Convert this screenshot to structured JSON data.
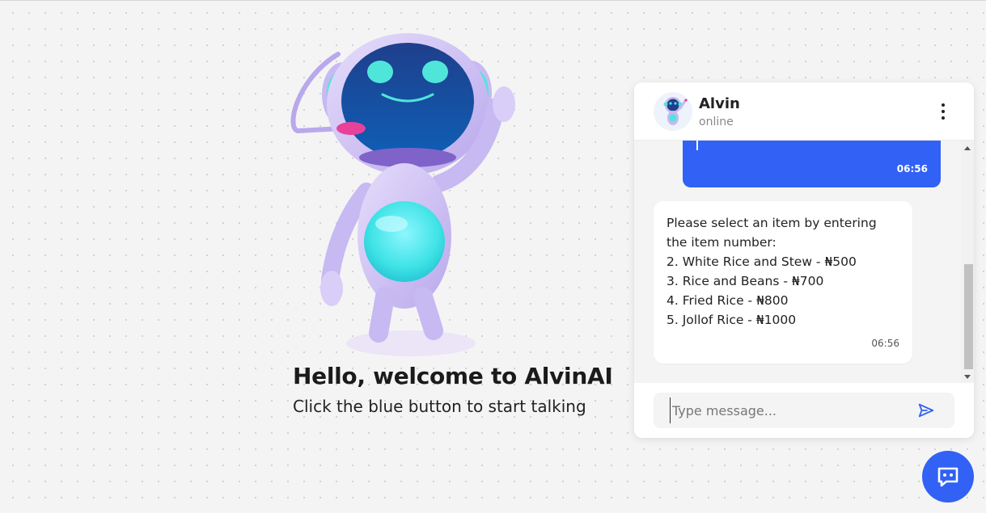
{
  "hero": {
    "title": "Hello, welcome to AlvinAI",
    "subtitle": "Click the blue button to start talking",
    "image_icon": "robot-mascot-icon"
  },
  "chat": {
    "header": {
      "name": "Alvin",
      "status": "online",
      "avatar_icon": "robot-avatar-icon",
      "menu_icon": "vertical-dots-icon"
    },
    "messages": [
      {
        "sender": "user",
        "time": "06:56"
      },
      {
        "sender": "bot",
        "lines": [
          "Please select an item by entering",
          "the item number:",
          "2. White Rice and Stew - ₦500",
          "3. Rice and Beans - ₦700",
          "4. Fried Rice - ₦800",
          "5. Jollof Rice - ₦1000"
        ],
        "time": "06:56"
      }
    ],
    "input": {
      "placeholder": "Type message...",
      "value": ""
    },
    "send_icon": "send-icon"
  },
  "launcher": {
    "icon": "chat-bubble-icon"
  },
  "colors": {
    "accent": "#3161f5",
    "background": "#f4f4f4",
    "user_bubble": "#3161f5",
    "bot_bubble": "#ffffff"
  }
}
